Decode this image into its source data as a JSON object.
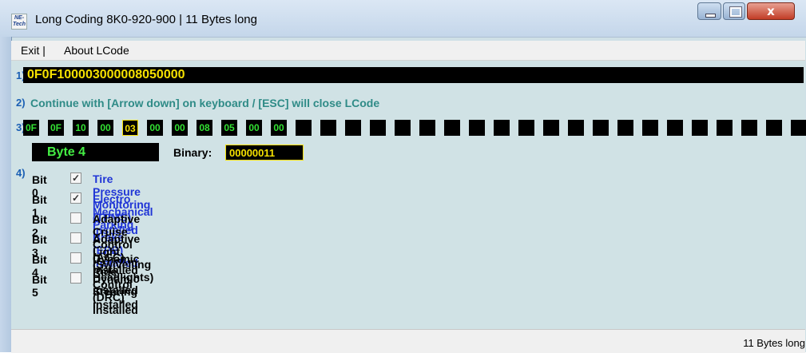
{
  "window": {
    "title": "Long Coding  8K0-920-900 | 11 Bytes long",
    "app_icon_text": "NE-Tech",
    "close_glyph": "x"
  },
  "menu": {
    "exit": "Exit |",
    "about": "About LCode"
  },
  "row_numbers": {
    "r1": "1)",
    "r2": "2)",
    "r3": "3)",
    "r4": "4)"
  },
  "coding": {
    "value": "0F0F100003000008050000"
  },
  "hint": "Continue with [Arrow down] on keyboard / [ESC] will close LCode",
  "bytes": [
    "0F",
    "0F",
    "10",
    "00",
    "03",
    "00",
    "00",
    "08",
    "05",
    "00",
    "00",
    "",
    "",
    "",
    "",
    "",
    "",
    "",
    "",
    "",
    "",
    "",
    "",
    "",
    "",
    "",
    "",
    "",
    "",
    "",
    "",
    ""
  ],
  "selected_byte_index": 4,
  "byte_info": {
    "label": "Byte 4",
    "binary_label": "Binary:",
    "binary_value": "00000011"
  },
  "bits": [
    {
      "label": "Bit 0",
      "checked": true,
      "check_glyph": "✓",
      "description": "Tire Pressure Monitoring (TPMS) installed"
    },
    {
      "label": "Bit 1",
      "checked": true,
      "check_glyph": "✓",
      "description": "Electro Mechanical Parking Brake (EPB) installed"
    },
    {
      "label": "Bit 2",
      "checked": false,
      "check_glyph": "",
      "description": "Adaptive Cruise Control (ACC) installed"
    },
    {
      "label": "Bit 3",
      "checked": false,
      "check_glyph": "",
      "description": "Adaptive Light (Swivelling Headlights) installed"
    },
    {
      "label": "Bit 4",
      "checked": false,
      "check_glyph": "",
      "description": "Dynamic Ride Control (DRC) installed"
    },
    {
      "label": "Bit 5",
      "checked": false,
      "check_glyph": "",
      "description": "Dynamic Steering installed"
    }
  ],
  "status": "11 Bytes long",
  "colors": {
    "background": "#d0e2e5",
    "field_bg": "#000000",
    "hex_yellow": "#f5e000",
    "hex_green": "#33e033",
    "hint_teal": "#2f8b87",
    "checked_blue": "#2035d6",
    "row_number_blue": "#1a5fb4"
  }
}
